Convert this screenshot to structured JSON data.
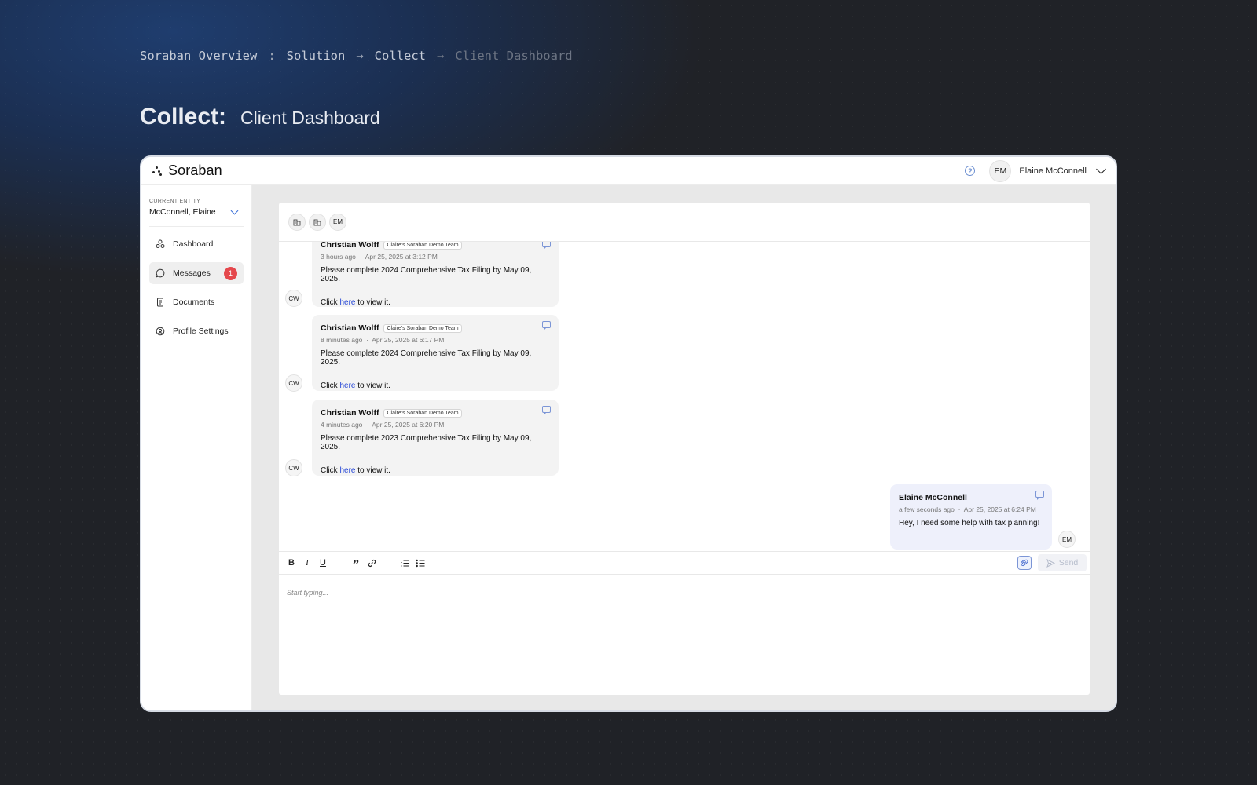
{
  "breadcrumb": {
    "root": "Soraban Overview",
    "colon": ":",
    "arrow": "→",
    "items": [
      "Solution",
      "Collect",
      "Client Dashboard"
    ]
  },
  "heading": {
    "main": "Collect:",
    "sub": "Client Dashboard"
  },
  "app": {
    "logo": "Soraban",
    "user_initials": "EM",
    "user_name": "Elaine McConnell"
  },
  "sidebar": {
    "entity_label": "CURRENT ENTITY",
    "entity_name": "McConnell, Elaine",
    "items": [
      {
        "label": "Dashboard",
        "icon": "dashboard-icon"
      },
      {
        "label": "Messages",
        "icon": "chat-icon",
        "badge": "1",
        "active": true
      },
      {
        "label": "Documents",
        "icon": "document-icon"
      },
      {
        "label": "Profile Settings",
        "icon": "profile-settings-icon"
      }
    ]
  },
  "participants": [
    "building-icon",
    "building-icon",
    "EM"
  ],
  "messages": [
    {
      "sender": "Christian Wolff",
      "team": "Claire's Soraban Demo Team",
      "ago": "3 hours ago",
      "date": "Apr 25, 2025 at 3:12 PM",
      "body": "Please complete 2024 Comprehensive Tax Filing by May 09, 2025.",
      "click_pre": "Click",
      "click_link": "here",
      "click_post": "to view it.",
      "initials": "CW"
    },
    {
      "sender": "Christian Wolff",
      "team": "Claire's Soraban Demo Team",
      "ago": "8 minutes ago",
      "date": "Apr 25, 2025 at 6:17 PM",
      "body": "Please complete 2024 Comprehensive Tax Filing by May 09, 2025.",
      "click_pre": "Click",
      "click_link": "here",
      "click_post": "to view it.",
      "initials": "CW"
    },
    {
      "sender": "Christian Wolff",
      "team": "Claire's Soraban Demo Team",
      "ago": "4 minutes ago",
      "date": "Apr 25, 2025 at 6:20 PM",
      "body": "Please complete 2023 Comprehensive Tax Filing by May 09, 2025.",
      "click_pre": "Click",
      "click_link": "here",
      "click_post": "to view it.",
      "initials": "CW"
    },
    {
      "sender": "Elaine McConnell",
      "ago": "a few seconds ago",
      "date": "Apr 25, 2025 at 6:24 PM",
      "body": "Hey, I need some help with tax planning!",
      "initials": "EM"
    }
  ],
  "meta_separator": "·",
  "toolbar": {
    "bold": "B",
    "italic": "I",
    "underline": "U",
    "quote": "”",
    "send_label": "Send"
  },
  "editor": {
    "placeholder": "Start typing..."
  }
}
